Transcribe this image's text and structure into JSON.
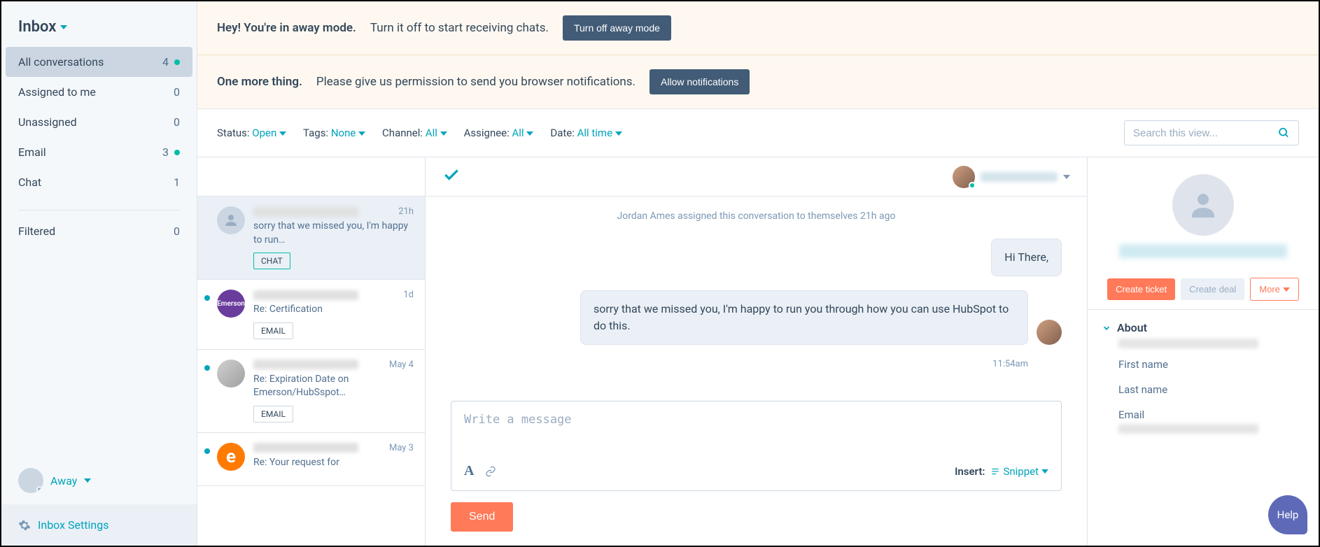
{
  "sidebar": {
    "inbox_label": "Inbox",
    "items": [
      {
        "label": "All conversations",
        "count": "4",
        "unread": true,
        "active": true
      },
      {
        "label": "Assigned to me",
        "count": "0",
        "unread": false
      },
      {
        "label": "Unassigned",
        "count": "0",
        "unread": false
      },
      {
        "label": "Email",
        "count": "3",
        "unread": true
      },
      {
        "label": "Chat",
        "count": "1",
        "unread": false
      }
    ],
    "filtered_label": "Filtered",
    "filtered_count": "0",
    "status_label": "Away",
    "settings_label": "Inbox Settings"
  },
  "banners": {
    "away_title": "Hey! You're in away mode.",
    "away_text": "Turn it off to start receiving chats.",
    "away_button": "Turn off away mode",
    "perm_title": "One more thing.",
    "perm_text": "Please give us permission to send you browser notifications.",
    "perm_button": "Allow notifications"
  },
  "filters": {
    "status": {
      "label": "Status:",
      "value": "Open"
    },
    "tags": {
      "label": "Tags:",
      "value": "None"
    },
    "channel": {
      "label": "Channel:",
      "value": "All"
    },
    "assignee": {
      "label": "Assignee:",
      "value": "All"
    },
    "date": {
      "label": "Date:",
      "value": "All time"
    },
    "search_placeholder": "Search this view..."
  },
  "threads": [
    {
      "time": "21h",
      "preview": "sorry that we missed you, I'm happy to run…",
      "badge": "CHAT",
      "badge_style": "teal",
      "unread": false,
      "avatar": "silhouette",
      "active": true
    },
    {
      "time": "1d",
      "preview": "Re: Certification",
      "badge": "EMAIL",
      "badge_style": "gray",
      "unread": true,
      "avatar": "purple",
      "avatar_text": "Emerson"
    },
    {
      "time": "May 4",
      "preview": "Re: Expiration Date on Emerson/HubSspot…",
      "badge": "EMAIL",
      "badge_style": "gray",
      "unread": true,
      "avatar": "photo"
    },
    {
      "time": "May 3",
      "preview": "Re: Your request for",
      "badge": "",
      "unread": true,
      "avatar": "orange",
      "avatar_text": "e"
    }
  ],
  "conversation": {
    "system_message": "Jordan Ames assigned this conversation to themselves 21h ago",
    "messages": [
      {
        "text": "Hi There,",
        "short": true
      },
      {
        "text": "sorry that we missed you, I'm happy to run you through how you can use HubSpot to do this."
      }
    ],
    "last_time": "11:54am",
    "composer_placeholder": "Write a message",
    "insert_label": "Insert:",
    "snippet_label": "Snippet",
    "send_label": "Send"
  },
  "detail": {
    "create_ticket": "Create ticket",
    "create_deal": "Create deal",
    "more": "More",
    "about_label": "About",
    "fields": [
      {
        "label": "First name"
      },
      {
        "label": "Last name"
      },
      {
        "label": "Email"
      }
    ]
  },
  "help_label": "Help"
}
